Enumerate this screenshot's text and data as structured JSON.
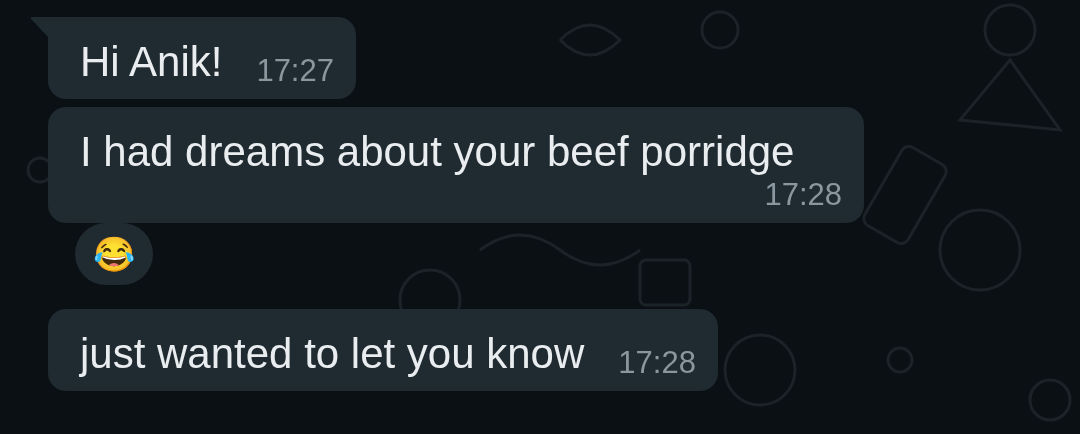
{
  "messages": [
    {
      "kind": "text",
      "text": "Hi Anik!",
      "time": "17:27",
      "tail": true
    },
    {
      "kind": "text",
      "text": "I had dreams about your beef porridge",
      "time": "17:28",
      "tail": false
    },
    {
      "kind": "emoji",
      "text": "😂"
    },
    {
      "kind": "text",
      "text": "just wanted to let you know",
      "time": "17:28",
      "tail": false
    }
  ]
}
